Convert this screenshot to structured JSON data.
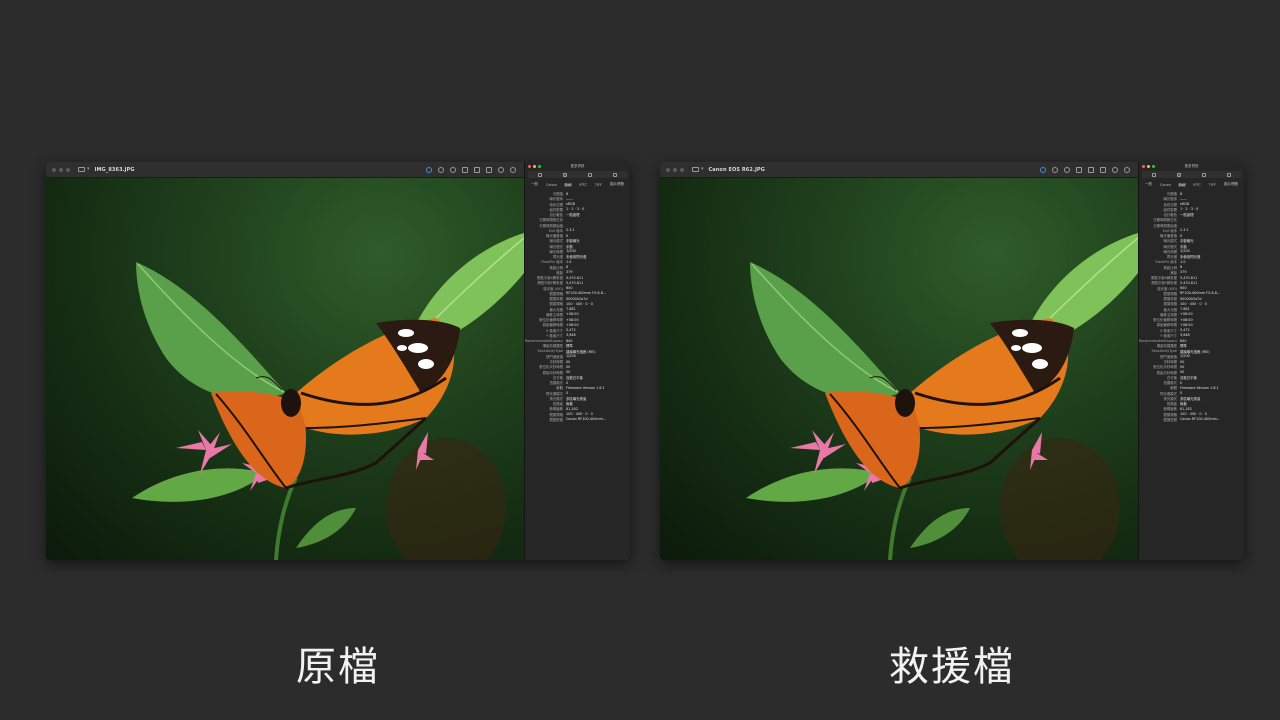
{
  "colors": {
    "background": "#2c2c2c",
    "window_frame": "#1e1e1e",
    "titlebar": "#2f2f2f",
    "inspector": "#262626",
    "traffic_red": "#ff5f57",
    "traffic_yellow": "#febc2e",
    "traffic_green": "#28c840",
    "accent": "#3b8eea",
    "caption_text": "#f2f2f2"
  },
  "windows": [
    {
      "title": "IMG_8363.JPG",
      "caption": "原檔",
      "toolbar_icons": [
        "info-icon",
        "zoom-out-icon",
        "zoom-in-icon",
        "share-icon",
        "markup-icon",
        "rotate-icon",
        "markup-circle-icon",
        "search-icon"
      ],
      "inspector": {
        "title": "更多資訊",
        "icons": [
          "info-tab-icon",
          "exif-tab-icon",
          "adjust-tab-icon",
          "pencil-tab-icon"
        ],
        "tabs": [
          "一般",
          "Canon",
          "Exif",
          "IPTC",
          "TIFF",
          "圖片標籤"
        ],
        "active_tab": "Exif"
      }
    },
    {
      "title": "Canon EOS R62.JPG",
      "caption": "救援檔",
      "toolbar_icons": [
        "info-icon",
        "zoom-out-icon",
        "zoom-in-icon",
        "share-icon",
        "markup-icon",
        "rotate-icon",
        "markup-circle-icon",
        "search-icon"
      ],
      "inspector": {
        "title": "更多資訊",
        "icons": [
          "info-tab-icon",
          "exif-tab-icon",
          "adjust-tab-icon",
          "pencil-tab-icon"
        ],
        "tabs": [
          "一般",
          "Canon",
          "Exif",
          "IPTC",
          "TIFF",
          "圖片標籤"
        ],
        "active_tab": "Exif"
      }
    }
  ],
  "exif_rows": [
    [
      "光圈值",
      "8"
    ],
    [
      "曝光程序",
      "——"
    ],
    [
      "色彩空間",
      "sRGB"
    ],
    [
      "組件配置",
      "1 · 2 · 3 · 0"
    ],
    [
      "自訂著色",
      "一般處理"
    ],
    [
      "日期時間數位化",
      ""
    ],
    [
      "日期時間原始值",
      ""
    ],
    [
      "Exif 版本",
      "2.3.1"
    ],
    [
      "曝光偏差值",
      "0"
    ],
    [
      "曝光模式",
      "手動曝光"
    ],
    [
      "曝光程式",
      "手動"
    ],
    [
      "曝光時間",
      "1/200"
    ],
    [
      "閃光燈",
      "未使用閃光燈"
    ],
    [
      "FlashPix 版本",
      "1.0"
    ],
    [
      "焦距比例",
      "8"
    ],
    [
      "焦距",
      "379"
    ],
    [
      "焦點平面X解析度",
      "5,470.811"
    ],
    [
      "焦點平面Y解析度",
      "5,470.811"
    ],
    [
      "感光度 (ISO)",
      "640"
    ],
    [
      "鏡頭規格",
      "RF100-400mm F5.6-8..."
    ],
    [
      "鏡頭序號",
      "0000002a7d"
    ],
    [
      "鏡頭規格",
      "100 · 400 · 0 · 0"
    ],
    [
      "最大光圈",
      "7.881"
    ],
    [
      "偏移主時間",
      "+08:00"
    ],
    [
      "數位化偏移時間",
      "+08:00"
    ],
    [
      "原始偏移時間",
      "+08:00"
    ],
    [
      "X 像素尺寸",
      "5,472"
    ],
    [
      "Y 像素尺寸",
      "3,648"
    ],
    [
      "RecommendedExposureI...",
      "640"
    ],
    [
      "場景拍攝類型",
      "標準"
    ],
    [
      "SensitivityType",
      "建議曝光指數 (REI)"
    ],
    [
      "快門速度值",
      "1/200"
    ],
    [
      "次秒時間",
      "00"
    ],
    [
      "數位化次秒時間",
      "00"
    ],
    [
      "原始次秒時間",
      "00"
    ],
    [
      "白平衡",
      "自動白平衡"
    ],
    [
      "拍攝模式",
      "0"
    ],
    [
      "軟體",
      "Firmware Version 1.8.1"
    ],
    [
      "閃光燈模式",
      "0"
    ],
    [
      "測光模式",
      "多區曝光測量"
    ],
    [
      "拍攝者",
      "無著"
    ],
    [
      "數碼變焦",
      "81,182"
    ],
    [
      "鏡頭規格",
      "100 · 400 · 0 · 0"
    ],
    [
      "鏡頭型號",
      "Canon RF100-400mm..."
    ]
  ]
}
